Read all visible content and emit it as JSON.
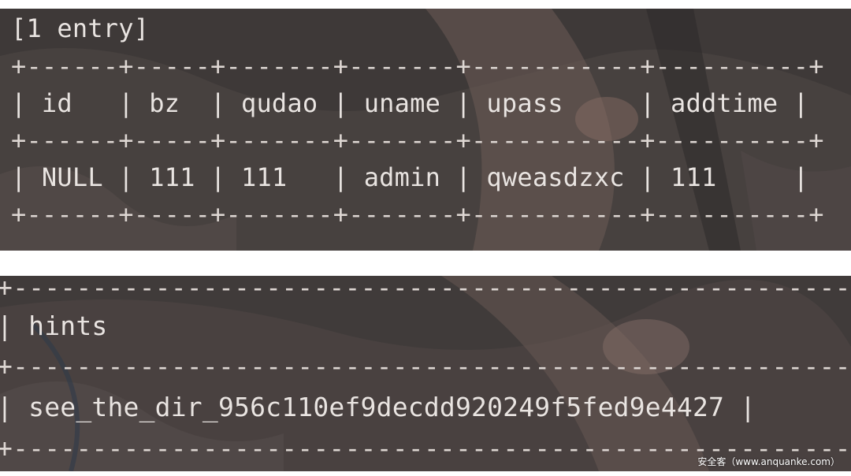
{
  "colors": {
    "panel_background": "#3f3a39",
    "text": "#e9e4e1"
  },
  "query_result": {
    "summary": "[1 entry]",
    "border": "+------+-----+-------+-------+-----------+----------+",
    "header": "| id   | bz  | qudao | uname | upass     | addtime |",
    "rows": [
      "| NULL | 111 | 111   | admin | qweasdzxc | 111     |"
    ]
  },
  "hints_result": {
    "border": "+------------------------------------------------------+",
    "header": "| hints                                                |",
    "rows": [
      "| see_the_dir_956c110ef9decdd920249f5fed9e4427 |"
    ]
  },
  "watermark": "安全客（www.anquanke.com）"
}
